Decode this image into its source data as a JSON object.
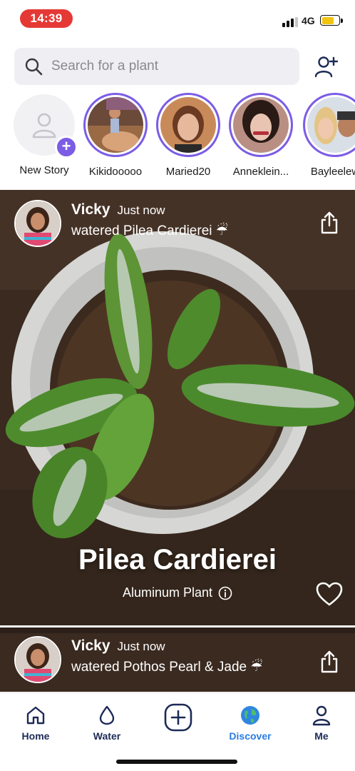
{
  "status_bar": {
    "time": "14:39",
    "network": "4G",
    "colors": {
      "time_pill": "#e53935",
      "battery": "#f2c40f"
    }
  },
  "search": {
    "placeholder": "Search for a plant",
    "icon": "search-icon"
  },
  "header": {
    "add_friend_icon": "add-person-icon"
  },
  "stories": [
    {
      "name": "New Story",
      "type": "new"
    },
    {
      "name": "Kikidooooo"
    },
    {
      "name": "Maried20"
    },
    {
      "name": "Anneklein..."
    },
    {
      "name": "Bayleelew"
    }
  ],
  "feed": [
    {
      "user": "Vicky",
      "time": "Just now",
      "action": "watered Pilea Cardierei ☔",
      "plant_name": "Pilea Cardierei",
      "common_name": "Aluminum Plant",
      "liked": false
    },
    {
      "user": "Vicky",
      "time": "Just now",
      "action": "watered Pothos Pearl & Jade ☔"
    }
  ],
  "nav": [
    {
      "label": "Home",
      "icon": "home-icon",
      "active": false
    },
    {
      "label": "Water",
      "icon": "water-drop-icon",
      "active": false
    },
    {
      "label": "",
      "icon": "add-icon",
      "active": false
    },
    {
      "label": "Discover",
      "icon": "globe-icon",
      "active": true
    },
    {
      "label": "Me",
      "icon": "person-icon",
      "active": false
    }
  ],
  "colors": {
    "accent": "#7b5ce5",
    "nav_text": "#1c2a56",
    "nav_active": "#2a7be4"
  }
}
